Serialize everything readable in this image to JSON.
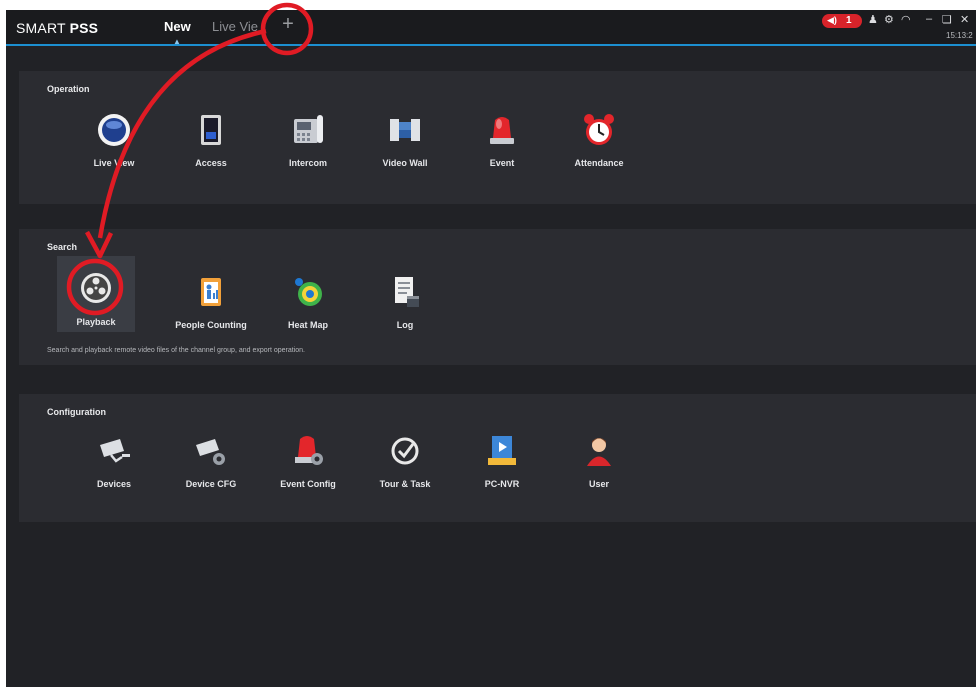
{
  "app": {
    "logo_light": "SMART ",
    "logo_bold": "PSS"
  },
  "tabs": [
    {
      "label": "New"
    },
    {
      "label": "Live View"
    }
  ],
  "add_tab_symbol": "+",
  "titlebar": {
    "alarm_count": "1",
    "clock": "15:13:2"
  },
  "sections": {
    "operation": {
      "title": "Operation",
      "items": [
        "Live View",
        "Access",
        "Intercom",
        "Video Wall",
        "Event",
        "Attendance"
      ]
    },
    "search": {
      "title": "Search",
      "items": [
        "Playback",
        "People Counting",
        "Heat Map",
        "Log"
      ],
      "description": "Search and playback remote video files of the channel group, and export operation."
    },
    "configuration": {
      "title": "Configuration",
      "items": [
        "Devices",
        "Device CFG",
        "Event Config",
        "Tour & Task",
        "PC-NVR",
        "User"
      ]
    }
  },
  "colors": {
    "background": "#212226",
    "panel": "#2b2c31",
    "accent": "#1c8fd0",
    "annotation": "#e01b24"
  }
}
